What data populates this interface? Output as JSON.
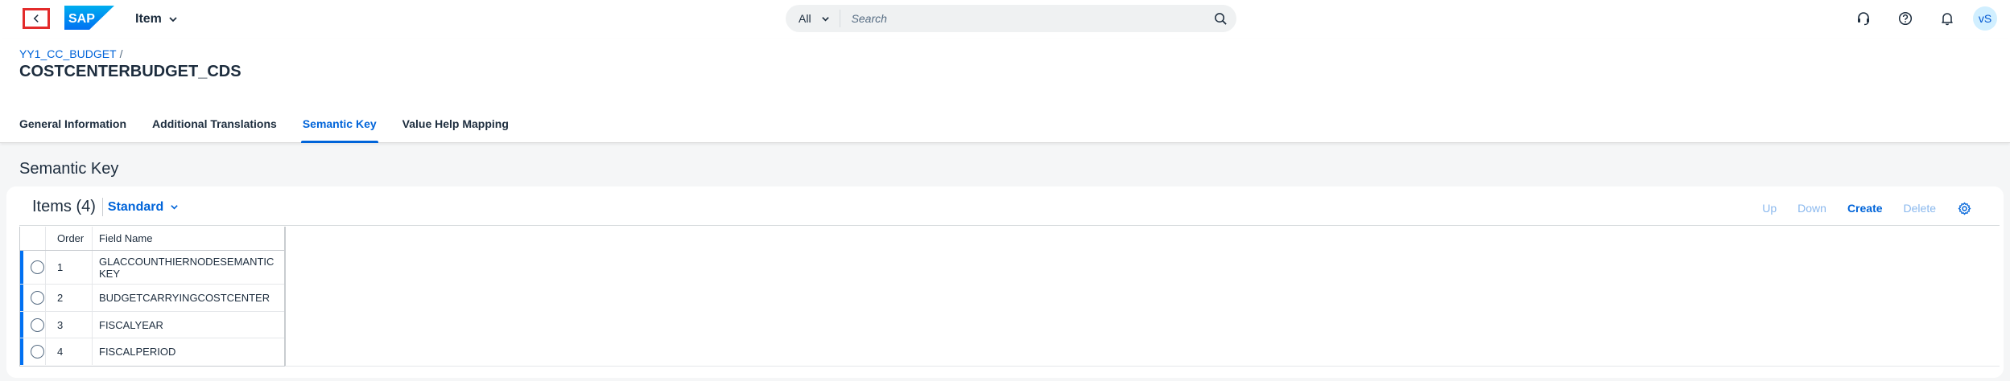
{
  "shell": {
    "logo_text": "SAP",
    "app_title": "Item",
    "search_scope": "All",
    "search_placeholder": "Search",
    "avatar_initials": "vS",
    "brand_color": "#0070f2"
  },
  "header": {
    "breadcrumb": [
      "YY1_CC_BUDGET"
    ],
    "breadcrumb_separator": "/",
    "title": "COSTCENTERBUDGET_CDS",
    "tabs": [
      {
        "label": "General Information",
        "active": false
      },
      {
        "label": "Additional Translations",
        "active": false
      },
      {
        "label": "Semantic Key",
        "active": true
      },
      {
        "label": "Value Help Mapping",
        "active": false
      }
    ]
  },
  "section": {
    "title": "Semantic Key"
  },
  "table": {
    "title": "Items (4)",
    "variant": "Standard",
    "toolbar": {
      "up": "Up",
      "down": "Down",
      "create": "Create",
      "delete": "Delete"
    },
    "columns": [
      "Order",
      "Field Name"
    ],
    "rows": [
      {
        "order": "1",
        "field": "GLACCOUNTHIERNODESEMANTICKEY"
      },
      {
        "order": "2",
        "field": "BUDGETCARRYINGCOSTCENTER"
      },
      {
        "order": "3",
        "field": "FISCALYEAR"
      },
      {
        "order": "4",
        "field": "FISCALPERIOD"
      }
    ]
  }
}
